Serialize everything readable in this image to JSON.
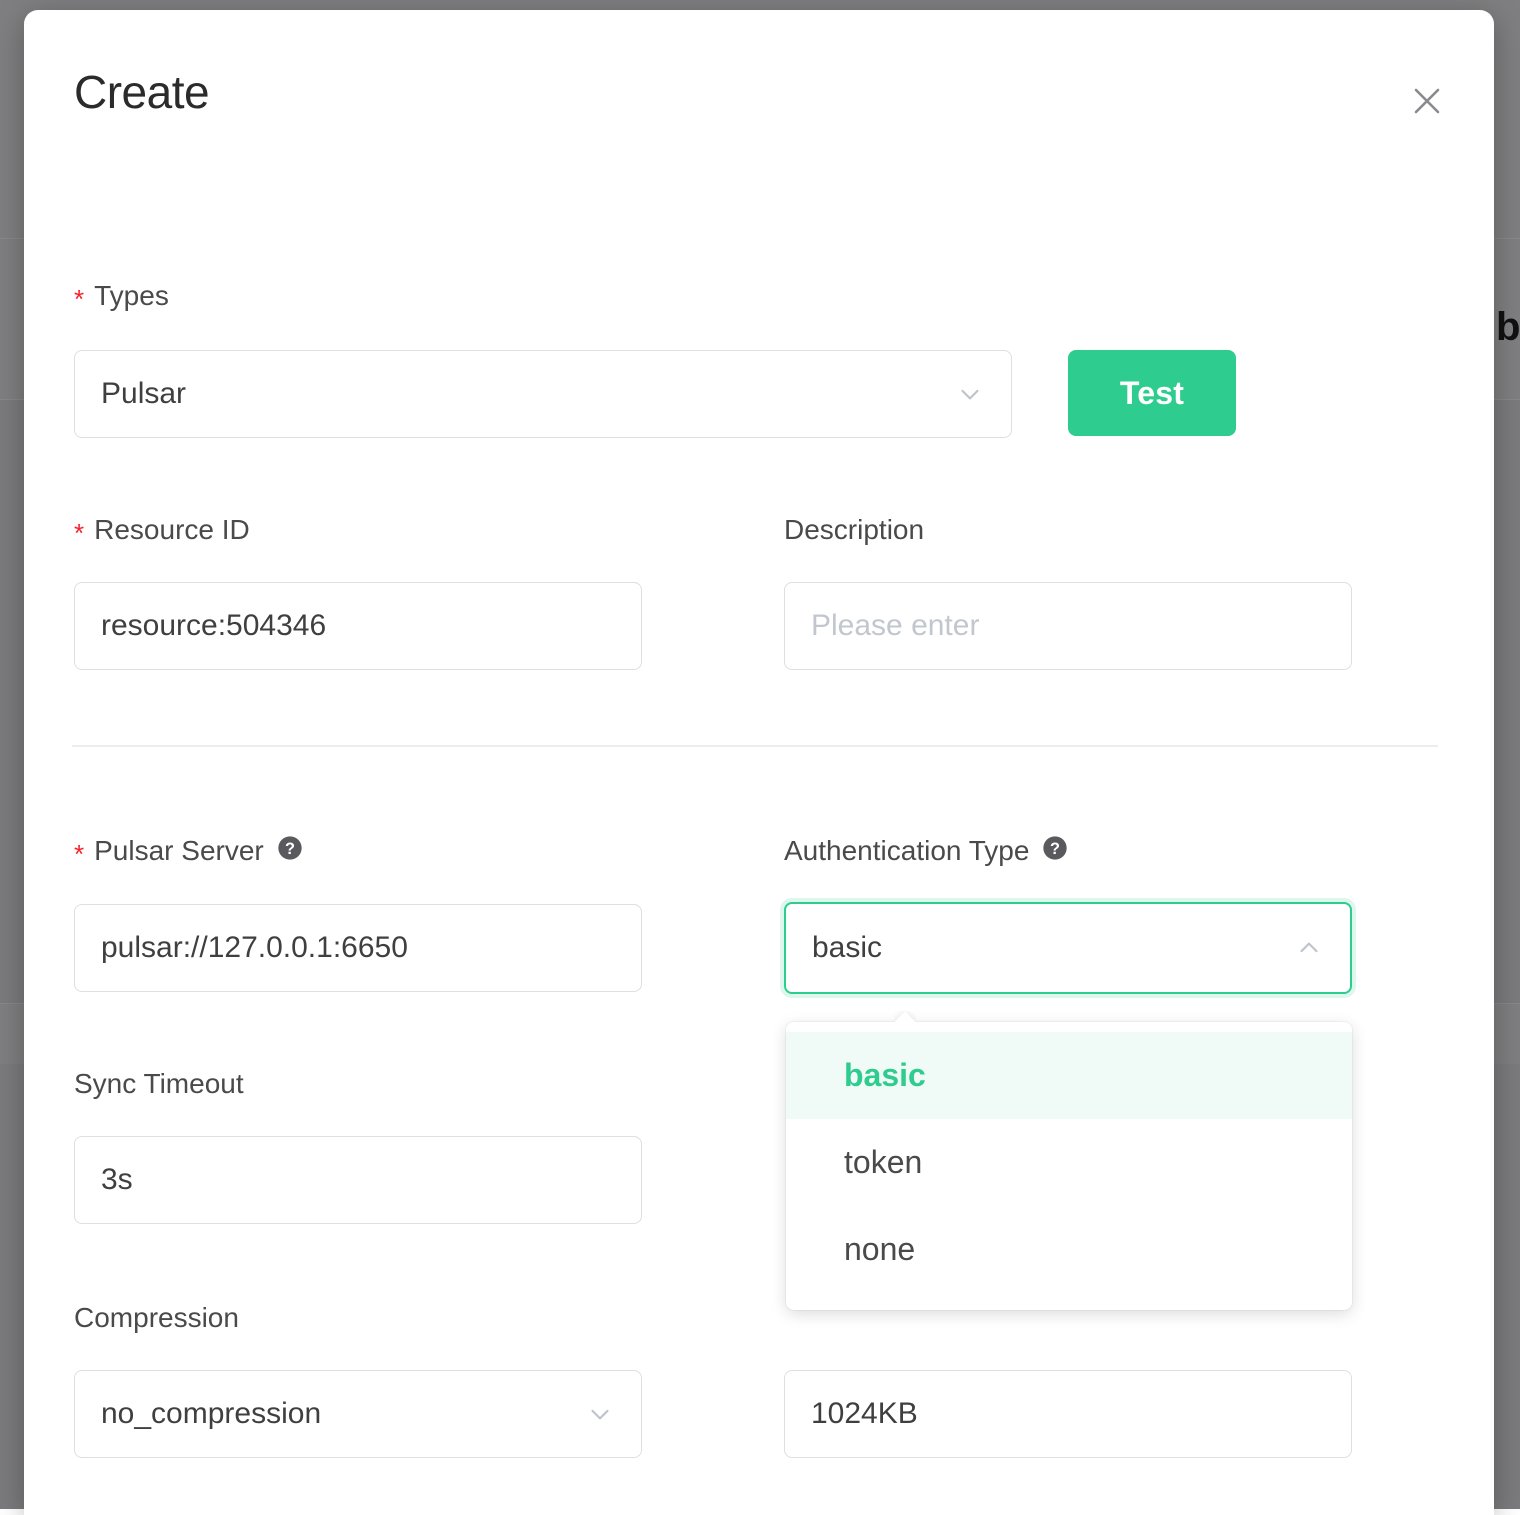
{
  "background": {
    "fragment_text": "b"
  },
  "modal": {
    "title": "Create",
    "close_icon": "close-icon"
  },
  "form": {
    "types": {
      "label": "Types",
      "required_marker": "*",
      "value": "Pulsar",
      "chevron": "chevron-down-icon"
    },
    "test_button": {
      "label": "Test",
      "color": "#2ECC8F"
    },
    "resource_id": {
      "label": "Resource ID",
      "required_marker": "*",
      "value": "resource:504346"
    },
    "description": {
      "label": "Description",
      "value": "",
      "placeholder": "Please enter"
    },
    "pulsar_server": {
      "label": "Pulsar Server",
      "required_marker": "*",
      "help_icon": "question-circle-icon",
      "value": "pulsar://127.0.0.1:6650"
    },
    "authentication_type": {
      "label": "Authentication Type",
      "help_icon": "question-circle-icon",
      "value": "basic",
      "chevron": "chevron-up-icon",
      "expanded": true,
      "options": [
        {
          "label": "basic",
          "selected": true
        },
        {
          "label": "token",
          "selected": false
        },
        {
          "label": "none",
          "selected": false
        }
      ]
    },
    "sync_timeout": {
      "label": "Sync Timeout",
      "value": "3s"
    },
    "compression": {
      "label": "Compression",
      "value": "no_compression",
      "chevron": "chevron-down-icon"
    },
    "batch_size": {
      "label": "",
      "value": "1024KB"
    }
  },
  "colors": {
    "accent": "#2ECC8F",
    "required": "#f5222d",
    "border": "#dcdfe3",
    "text": "#4a4a4a",
    "placeholder": "#c2c7cf",
    "overlay": "#7b7b7d"
  }
}
